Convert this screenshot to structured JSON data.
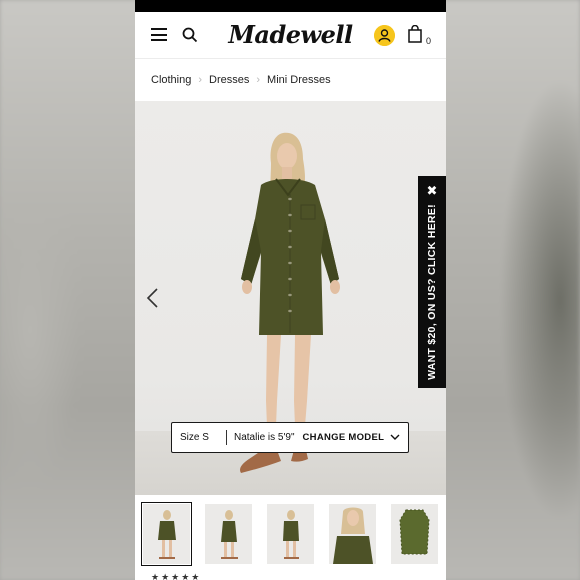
{
  "header": {
    "brand": "Madewell",
    "bag_count": "0"
  },
  "breadcrumb": {
    "items": [
      "Clothing",
      "Dresses",
      "Mini Dresses"
    ],
    "separator": "›"
  },
  "promo": {
    "text": "WANT $20, ON US? CLICK HERE!",
    "close": "✖"
  },
  "model_bar": {
    "size": "Size S",
    "model": "Natalie is 5'9\"",
    "change_label": "CHANGE MODEL"
  },
  "colors": {
    "dress": "#4d5227",
    "account_icon": "#f6c51c",
    "promo_bg": "#0d0d0d"
  },
  "icons": [
    "hamburger-icon",
    "search-icon",
    "account-icon",
    "bag-icon",
    "chevron-left-icon",
    "close-icon",
    "chevron-down-icon"
  ]
}
